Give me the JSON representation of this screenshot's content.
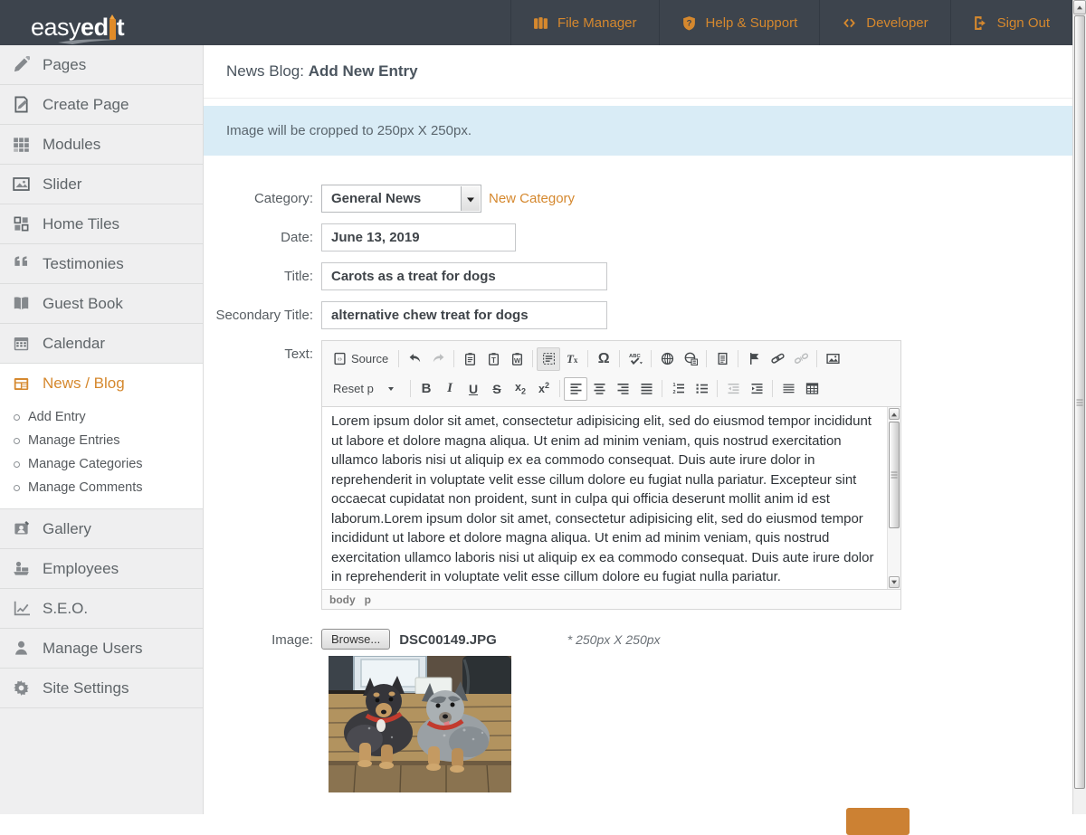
{
  "colors": {
    "accent": "#d5882e",
    "header_bg": "#3d444d",
    "banner_bg": "#d9ecf6"
  },
  "header": {
    "logo": {
      "text_light": "easy",
      "text_bold_1": "ed",
      "text_bold_2": "t"
    },
    "nav": [
      {
        "label": "File Manager",
        "icon": "folders-icon"
      },
      {
        "label": "Help & Support",
        "icon": "shield-question-icon"
      },
      {
        "label": "Developer",
        "icon": "code-icon"
      },
      {
        "label": "Sign Out",
        "icon": "signout-icon"
      }
    ]
  },
  "sidebar": {
    "items": [
      {
        "label": "Pages",
        "icon": "pencil-icon"
      },
      {
        "label": "Create Page",
        "icon": "create-page-icon"
      },
      {
        "label": "Modules",
        "icon": "grid-icon"
      },
      {
        "label": "Slider",
        "icon": "picture-icon"
      },
      {
        "label": "Home Tiles",
        "icon": "tiles-icon"
      },
      {
        "label": "Testimonies",
        "icon": "quotes-icon"
      },
      {
        "label": "Guest Book",
        "icon": "book-icon"
      },
      {
        "label": "Calendar",
        "icon": "calendar-icon"
      },
      {
        "label": "News / Blog",
        "icon": "newspaper-icon",
        "active": true,
        "children": [
          "Add Entry",
          "Manage Entries",
          "Manage Categories",
          "Manage Comments"
        ]
      },
      {
        "label": "Gallery",
        "icon": "gallery-icon"
      },
      {
        "label": "Employees",
        "icon": "employee-icon"
      },
      {
        "label": "S.E.O.",
        "icon": "chart-icon"
      },
      {
        "label": "Manage Users",
        "icon": "user-icon"
      },
      {
        "label": "Site Settings",
        "icon": "gear-icon"
      }
    ]
  },
  "main": {
    "page_title_prefix": "News Blog: ",
    "page_title_bold": "Add New Entry",
    "banner_text": "Image will be cropped to 250px X 250px.",
    "form": {
      "category": {
        "label": "Category:",
        "value": "General News",
        "new_link": "New Category"
      },
      "date": {
        "label": "Date:",
        "value": "June 13, 2019"
      },
      "title": {
        "label": "Title:",
        "value": "Carots as a treat for dogs"
      },
      "secondary": {
        "label": "Secondary Title:",
        "value": "alternative chew treat for dogs"
      },
      "text": {
        "label": "Text:"
      },
      "image": {
        "label": "Image:",
        "browse_label": "Browse...",
        "filename": "DSC00149.JPG",
        "note": "* 250px X 250px",
        "photo_alt": "two cattle dogs with red collars lying on a wooden deck"
      }
    }
  },
  "editor": {
    "source_label": "Source",
    "format_value": "Reset p",
    "path": [
      "body",
      "p"
    ],
    "content": "Lorem ipsum dolor sit amet, consectetur adipisicing elit, sed do eiusmod tempor incididunt ut labore et dolore magna aliqua. Ut enim ad minim veniam, quis nostrud exercitation ullamco laboris nisi ut aliquip ex ea commodo consequat. Duis aute irure dolor in reprehenderit in voluptate velit esse cillum dolore eu fugiat nulla pariatur. Excepteur sint occaecat cupidatat non proident, sunt in culpa qui officia deserunt mollit anim id est laborum.Lorem ipsum dolor sit amet, consectetur adipisicing elit, sed do eiusmod tempor incididunt ut labore et dolore magna aliqua. Ut enim ad minim veniam, quis nostrud exercitation ullamco laboris nisi ut aliquip ex ea commodo consequat. Duis aute irure dolor in reprehenderit in voluptate velit esse cillum dolore eu fugiat nulla pariatur.",
    "toolbar_row1": [
      {
        "t": "source"
      },
      {
        "t": "sep"
      },
      {
        "t": "btn",
        "name": "undo-icon"
      },
      {
        "t": "btn",
        "name": "redo-icon",
        "state": "disabled"
      },
      {
        "t": "sep"
      },
      {
        "t": "btn",
        "name": "paste-icon"
      },
      {
        "t": "btn",
        "name": "paste-text-icon"
      },
      {
        "t": "btn",
        "name": "paste-word-icon"
      },
      {
        "t": "sep"
      },
      {
        "t": "btn",
        "name": "select-all-icon",
        "state": "lit"
      },
      {
        "t": "btn",
        "name": "remove-format-icon"
      },
      {
        "t": "sep"
      },
      {
        "t": "btn",
        "name": "special-char-icon"
      },
      {
        "t": "sep"
      },
      {
        "t": "btn",
        "name": "spellcheck-icon"
      },
      {
        "t": "sep"
      },
      {
        "t": "btn",
        "name": "globe-icon"
      },
      {
        "t": "btn",
        "name": "globe-document-icon"
      },
      {
        "t": "sep"
      },
      {
        "t": "btn",
        "name": "document-icon"
      },
      {
        "t": "sep"
      },
      {
        "t": "btn",
        "name": "anchor-flag-icon"
      },
      {
        "t": "btn",
        "name": "link-icon"
      },
      {
        "t": "btn",
        "name": "unlink-icon",
        "state": "disabled"
      },
      {
        "t": "sep"
      },
      {
        "t": "btn",
        "name": "insert-image-icon"
      }
    ],
    "toolbar_row2": [
      {
        "t": "combo"
      },
      {
        "t": "sep"
      },
      {
        "t": "btn",
        "name": "bold-icon"
      },
      {
        "t": "btn",
        "name": "italic-icon"
      },
      {
        "t": "btn",
        "name": "underline-icon"
      },
      {
        "t": "btn",
        "name": "strikethrough-icon"
      },
      {
        "t": "btn",
        "name": "subscript-icon"
      },
      {
        "t": "btn",
        "name": "superscript-icon"
      },
      {
        "t": "sep"
      },
      {
        "t": "btn",
        "name": "align-left-icon",
        "state": "on"
      },
      {
        "t": "btn",
        "name": "align-center-icon"
      },
      {
        "t": "btn",
        "name": "align-right-icon"
      },
      {
        "t": "btn",
        "name": "align-justify-icon"
      },
      {
        "t": "sep"
      },
      {
        "t": "btn",
        "name": "numbered-list-icon"
      },
      {
        "t": "btn",
        "name": "bulleted-list-icon"
      },
      {
        "t": "sep"
      },
      {
        "t": "btn",
        "name": "outdent-icon",
        "state": "disabled"
      },
      {
        "t": "btn",
        "name": "indent-icon"
      },
      {
        "t": "sep"
      },
      {
        "t": "btn",
        "name": "horizontal-rule-icon"
      },
      {
        "t": "btn",
        "name": "table-icon"
      }
    ]
  }
}
